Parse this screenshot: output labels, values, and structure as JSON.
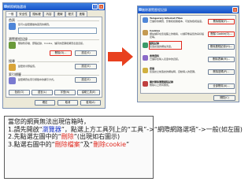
{
  "left_window": {
    "title": "網際網路選項",
    "tabs": [
      "一般",
      "安全性",
      "隱私權",
      "內容",
      "連線",
      "程式",
      "進階"
    ],
    "home_group": "首頁",
    "home_text": "您可以變更要做為首頁的網頁。",
    "temp_group": "瀏覽歷程記錄",
    "temp_text": "刪除暫存檔、歷程記錄、Cookie、儲存的密碼和網頁表單資訊。",
    "delete_button": "刪除(D)...",
    "settings_button": "設定(S)",
    "search_group": "搜尋",
    "search_text": "變更搜尋預設值。",
    "tabs_group": "索引標籤",
    "tabs_text": "變更網頁在索引標籤中的顯示方式。",
    "appearance": [
      "色彩(O)",
      "語言(L)",
      "字型(N)",
      "協助工具(E)"
    ],
    "ok": "確定",
    "cancel": "取消",
    "apply": "套用(A)"
  },
  "right_window": {
    "title": "刪除瀏覽歷程記錄",
    "temp_heading": "Temporary Internet Files",
    "temp_text": "已儲存的網頁、影像和媒體複本，可加快檢視速度。",
    "temp_button": "刪除檔案(F)...",
    "cookies_heading": "Cookies",
    "cookies_text": "網站儲存在您電腦上的檔案，以儲存像是您的喜好設定等。",
    "cookies_button": "刪除 Cookie(O)...",
    "history_heading": "歷程記錄",
    "history_text": "您造訪過的網站清單。",
    "history_button": "刪除歷程記錄(H)...",
    "form_heading": "表單資料",
    "form_text": "已儲存您輸入表單中的資訊。",
    "form_button": "刪除表單(M)...",
    "pw_heading": "密碼",
    "pw_text": "您造訪之前造訪的網站時，自動填入的密碼。",
    "pw_button": "刪除密碼(P)...",
    "all_heading": "關於刪除瀏覽歷程記錄",
    "all_text": "刪除以上所有類別。",
    "all_button": "全部刪除(A)...",
    "close_button": "關閉(C)"
  },
  "instructions": {
    "line1": "當您的網頁無法出現信箱時，",
    "line2_pre": "1.請先開啟“",
    "line2_blue": "瀏覽器",
    "line2_post": "”，點選上方工具列上的“工具”->“網際網路選項”->一般(如左圖)",
    "line3_pre": "2.先點選左圖中的“",
    "line3_red": "刪除",
    "line3_post": "”(出現如右圖示)",
    "line4_pre": "3.點選右圖中的“",
    "line4_red1": "刪除檔案",
    "line4_mid": "”及“",
    "line4_red2": "刪除cookie",
    "line4_post": "”"
  },
  "colors": {
    "accent_red": "#e0281e",
    "arrow": "#e8401f",
    "title_blue": "#1652c8",
    "link_blue": "#1a35c8"
  }
}
